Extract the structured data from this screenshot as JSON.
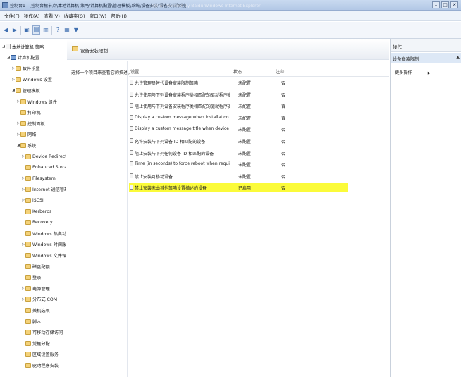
{
  "window": {
    "title": "控制台1 - [控制台根节点\\本地计算机 策略\\计算机配置\\管理模板\\系统\\设备安装\\设备安装限制]",
    "watermark": "[绑法]   Powered by Baidu   Windows Internet Explorer",
    "buttons": {
      "minimize": "–",
      "maximize": "□",
      "close": "✕"
    }
  },
  "menu": [
    "文件(F)",
    "操作(A)",
    "查看(V)",
    "收藏夹(O)",
    "窗口(W)",
    "帮助(H)"
  ],
  "toolbar": {
    "icons": [
      "back-icon",
      "forward-icon",
      "up-folder-icon",
      "show-tree-icon",
      "export-list-icon",
      "help-icon",
      "properties-icon",
      "filter-icon"
    ]
  },
  "tree": {
    "items": [
      {
        "label": "本地计算机 策略",
        "indent": 0,
        "twisty": "◢",
        "icon": "doc"
      },
      {
        "label": "计算机配置",
        "indent": 1,
        "twisty": "◢",
        "icon": "pc"
      },
      {
        "label": "软件设置",
        "indent": 2,
        "twisty": "▷",
        "icon": "folder"
      },
      {
        "label": "Windows 设置",
        "indent": 2,
        "twisty": "▷",
        "icon": "folder"
      },
      {
        "label": "管理模板",
        "indent": 2,
        "twisty": "◢",
        "icon": "folder"
      },
      {
        "label": "Windows 组件",
        "indent": 3,
        "twisty": "▷",
        "icon": "folder"
      },
      {
        "label": "打印机",
        "indent": 3,
        "twisty": "",
        "icon": "folder"
      },
      {
        "label": "控制面板",
        "indent": 3,
        "twisty": "▷",
        "icon": "folder"
      },
      {
        "label": "网络",
        "indent": 3,
        "twisty": "▷",
        "icon": "folder"
      },
      {
        "label": "系统",
        "indent": 3,
        "twisty": "◢",
        "icon": "folder"
      },
      {
        "label": "Device Redirection",
        "indent": 4,
        "twisty": "▷",
        "icon": "folder"
      },
      {
        "label": "Enhanced Storage A",
        "indent": 4,
        "twisty": "",
        "icon": "folder"
      },
      {
        "label": "Filesystem",
        "indent": 4,
        "twisty": "▷",
        "icon": "folder"
      },
      {
        "label": "Internet 通信管理",
        "indent": 4,
        "twisty": "▷",
        "icon": "folder"
      },
      {
        "label": "iSCSI",
        "indent": 4,
        "twisty": "▷",
        "icon": "folder"
      },
      {
        "label": "Kerberos",
        "indent": 4,
        "twisty": "",
        "icon": "folder"
      },
      {
        "label": "Recovery",
        "indent": 4,
        "twisty": "",
        "icon": "folder"
      },
      {
        "label": "Windows 热启动",
        "indent": 4,
        "twisty": "",
        "icon": "folder"
      },
      {
        "label": "Windows 时间服务",
        "indent": 4,
        "twisty": "▷",
        "icon": "folder"
      },
      {
        "label": "Windows 文件保护",
        "indent": 4,
        "twisty": "",
        "icon": "folder"
      },
      {
        "label": "磁盘配额",
        "indent": 4,
        "twisty": "",
        "icon": "folder"
      },
      {
        "label": "登录",
        "indent": 4,
        "twisty": "",
        "icon": "folder"
      },
      {
        "label": "电源管理",
        "indent": 4,
        "twisty": "▷",
        "icon": "folder"
      },
      {
        "label": "分布式 COM",
        "indent": 4,
        "twisty": "▷",
        "icon": "folder"
      },
      {
        "label": "关机选项",
        "indent": 4,
        "twisty": "",
        "icon": "folder"
      },
      {
        "label": "脚本",
        "indent": 4,
        "twisty": "",
        "icon": "folder"
      },
      {
        "label": "可移动存储访问",
        "indent": 4,
        "twisty": "",
        "icon": "folder"
      },
      {
        "label": "凭据分配",
        "indent": 4,
        "twisty": "",
        "icon": "folder"
      },
      {
        "label": "区域设置服务",
        "indent": 4,
        "twisty": "",
        "icon": "folder"
      },
      {
        "label": "驱动程序安装",
        "indent": 4,
        "twisty": "",
        "icon": "folder"
      }
    ]
  },
  "center": {
    "header_title": "设备安装限制",
    "description": "选择一个项目来查看它的描述。",
    "columns": {
      "setting": "设置",
      "state": "状态",
      "comment": "注释"
    },
    "rows": [
      {
        "name": "允许管理员替代设备安装限制策略",
        "state": "未配置",
        "comment": "否",
        "highlight": false
      },
      {
        "name": "允许使用与下列设备安装程序类相匹配的驱动程序安装设备",
        "state": "未配置",
        "comment": "否",
        "highlight": false
      },
      {
        "name": "阻止使用与下列设备安装程序类相匹配的驱动程序安装设备",
        "state": "未配置",
        "comment": "否",
        "highlight": false
      },
      {
        "name": "Display a custom message when installation is prevent...",
        "state": "未配置",
        "comment": "否",
        "highlight": false
      },
      {
        "name": "Display a custom message title when device installatio...",
        "state": "未配置",
        "comment": "否",
        "highlight": false
      },
      {
        "name": "允许安装与下列设备 ID 相匹配的设备",
        "state": "未配置",
        "comment": "否",
        "highlight": false
      },
      {
        "name": "阻止安装与下列任何设备 ID 相匹配的设备",
        "state": "未配置",
        "comment": "否",
        "highlight": false
      },
      {
        "name": "Time (in seconds) to force reboot when required for p...",
        "state": "未配置",
        "comment": "否",
        "highlight": false
      },
      {
        "name": "禁止安装可移动设备",
        "state": "未配置",
        "comment": "否",
        "highlight": false
      },
      {
        "name": "禁止安装未由其他策略设置描述的设备",
        "state": "已启用",
        "comment": "否",
        "highlight": true
      }
    ],
    "highlight_color": "#fbfb3a"
  },
  "actions": {
    "title": "操作",
    "section": "设备安装限制",
    "section_arrow": "▲",
    "more": "更多操作",
    "more_arrow": "▶"
  }
}
